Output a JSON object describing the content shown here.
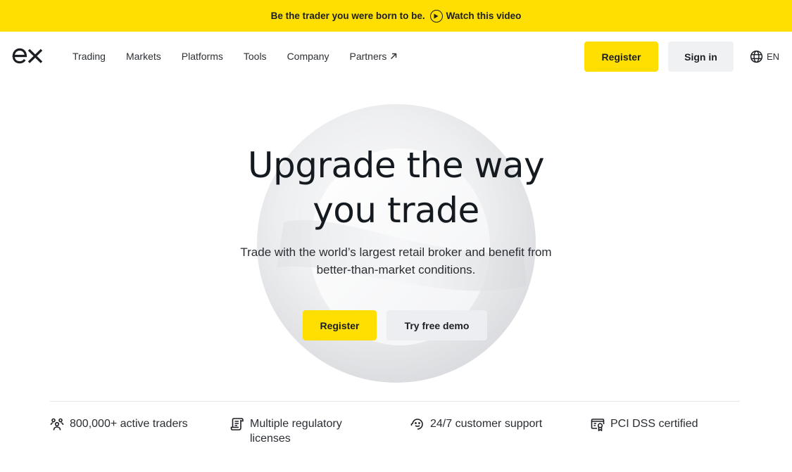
{
  "promo_banner": {
    "text": "Be the trader you were born to be.",
    "link_label": "Watch this video",
    "icon": "play-circle-icon",
    "background_color": "#ffde02"
  },
  "header": {
    "logo_text": "ex",
    "nav": [
      {
        "label": "Trading"
      },
      {
        "label": "Markets"
      },
      {
        "label": "Platforms"
      },
      {
        "label": "Tools"
      },
      {
        "label": "Company"
      },
      {
        "label": "Partners",
        "icon": "external-arrow-icon"
      }
    ],
    "register_label": "Register",
    "signin_label": "Sign in",
    "language": {
      "icon": "globe-icon",
      "label": "EN"
    }
  },
  "hero": {
    "title_line1": "Upgrade the way",
    "title_line2": "you trade",
    "subtitle_line1": "Trade with the world’s largest retail broker and benefit from",
    "subtitle_line2": "better-than-market conditions.",
    "register_label": "Register",
    "demo_label": "Try free demo"
  },
  "features": [
    {
      "icon": "users-icon",
      "text": "800,000+ active traders"
    },
    {
      "icon": "scroll-license-icon",
      "text": "Multiple regulatory licenses"
    },
    {
      "icon": "support-headset-icon",
      "text": "24/7 customer support"
    },
    {
      "icon": "certificate-icon",
      "text": "PCI DSS certified"
    }
  ],
  "colors": {
    "accent_yellow": "#ffde02",
    "text_dark": "#141a1f",
    "secondary_button": "#f0f1f3"
  }
}
